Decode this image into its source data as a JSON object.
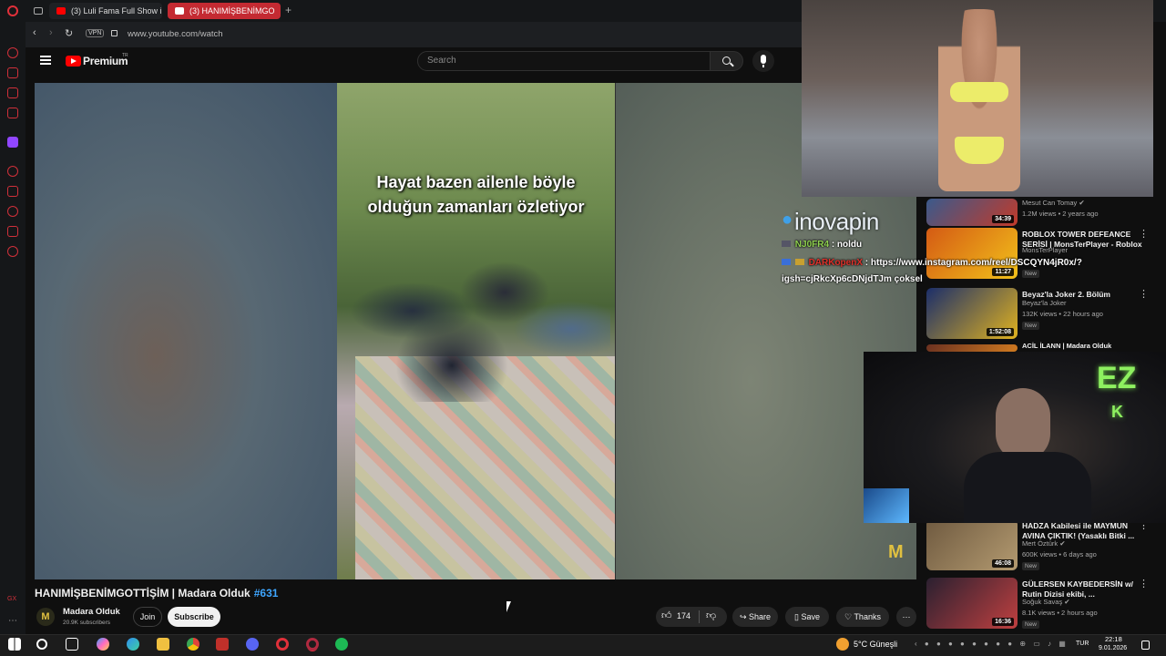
{
  "browser": {
    "tabs": [
      {
        "label": "(3) Luli Fama Full Show in"
      },
      {
        "label": "(3) HANIMİŞBENİMGO"
      }
    ],
    "new_tab_symbol": "+",
    "vpn_label": "VPN",
    "url": "www.youtube.com/watch"
  },
  "youtube": {
    "logo_text": "Premium",
    "logo_region": "TR",
    "search_placeholder": "Search"
  },
  "video": {
    "caption_line1": "Hayat bazen ailenle böyle",
    "caption_line2": "olduğun zamanları özletiyor",
    "watermark": "M",
    "title": "HANIMİŞBENİMGOTTİŞİM | Madara Olduk",
    "hashtag": "#631",
    "channel_name": "Madara Olduk",
    "channel_avatar": "M",
    "subscribers": "20.9K subscribers",
    "join_label": "Join",
    "subscribe_label": "Subscribe",
    "likes": "174",
    "share_label": "Share",
    "save_label": "Save",
    "thanks_label": "Thanks",
    "more_label": "⋯"
  },
  "chat_overlay": {
    "brand": "inovapin",
    "line1_user": "NJ0FR4",
    "line1_msg": ": noldu",
    "line2_user": "DARKopenX",
    "line2_msg": ": https://www.instagram.com/reel/DSCQYN4jR0x/?",
    "line3_msg": "igsh=cjRkcXp6cDNjdTJm çoksel"
  },
  "camera_overlay": {
    "sign_text": "EZ",
    "sign_text2": "K"
  },
  "recommendations": [
    {
      "title": "",
      "channel": "Mesut Can Tomay ✔",
      "meta": "1.2M views • 2 years ago",
      "duration": "34:39",
      "new": "",
      "colors": [
        "#3a5a8c",
        "#c23a2a"
      ]
    },
    {
      "title": "ROBLOX TOWER DEFEANCE SERİSİ | MonsTerPlayer - Roblox",
      "channel": "MonsTerPlayer",
      "meta": "",
      "duration": "11:27",
      "new": "New",
      "colors": [
        "#d45a14",
        "#f2c11a"
      ]
    },
    {
      "title": "Beyaz'la Joker 2. Bölüm",
      "channel": "Beyaz'la Joker",
      "meta": "132K views • 22 hours ago",
      "duration": "1:52:08",
      "new": "New",
      "colors": [
        "#1b2e6a",
        "#e0b220"
      ]
    },
    {
      "title": "ACİL İLANN | Madara Olduk",
      "channel": "",
      "meta": "",
      "duration": "",
      "new": "",
      "colors": [
        "#6a3020",
        "#d07a20"
      ]
    },
    {
      "title": "HADZA Kabilesi ile MAYMUN AVINA ÇIKTIK! (Yasaklı Bitki ...",
      "channel": "Mert Öztürk ✔",
      "meta": "600K views • 6 days ago",
      "duration": "46:08",
      "new": "New",
      "colors": [
        "#6f5a40",
        "#b39a70"
      ]
    },
    {
      "title": "GÜLERSEN KAYBEDERSİN w/ Rutin Dizisi ekibi, ...",
      "channel": "Soğuk Savaş ✔",
      "meta": "8.1K views • 2 hours ago",
      "duration": "16:36",
      "new": "New",
      "colors": [
        "#2a2030",
        "#c04040"
      ]
    }
  ],
  "taskbar": {
    "weather": "5°C  Güneşli",
    "language": "TUR",
    "time": "22:18",
    "date": "9.01.2026"
  }
}
